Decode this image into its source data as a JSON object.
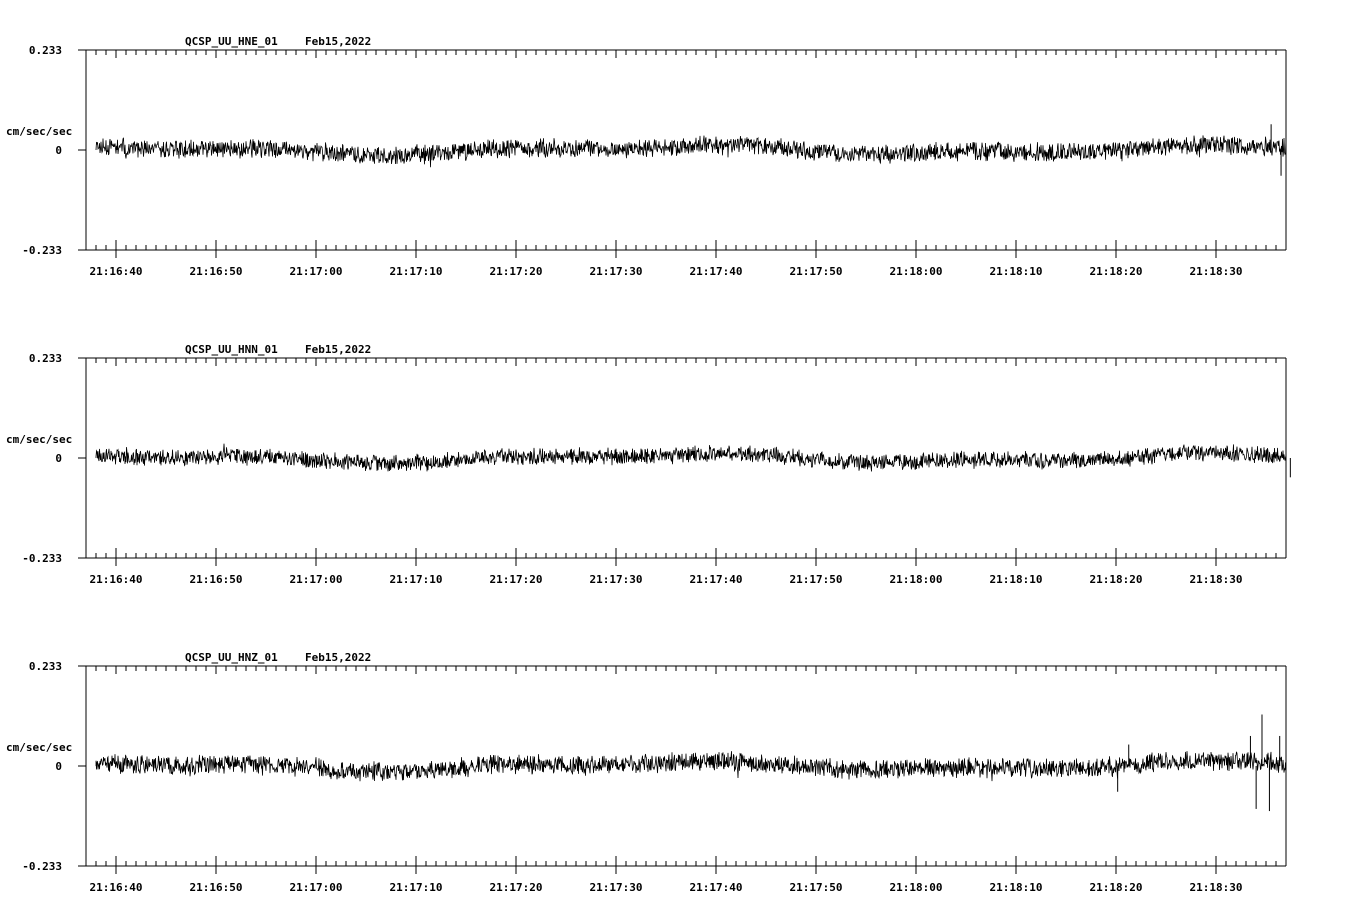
{
  "chart_data": [
    {
      "type": "line",
      "title": "QCSP_UU_HNE_01",
      "date": "Feb15,2022",
      "ylabel": "cm/sec/sec",
      "ylim": [
        -0.233,
        0.233
      ],
      "y_ticks": [
        "0.233",
        "0",
        "-0.233"
      ],
      "x_start": "21:16:37",
      "x_end": "21:18:37",
      "x_ticks": [
        "21:16:40",
        "21:16:50",
        "21:17:00",
        "21:17:10",
        "21:17:20",
        "21:17:30",
        "21:17:40",
        "21:17:50",
        "21:18:00",
        "21:18:10",
        "21:18:20",
        "21:18:30"
      ],
      "signal": {
        "data_start": "21:16:38",
        "noise_amplitude": 0.025,
        "drift_amplitude": 0.008,
        "seed": 11,
        "spikes": [
          {
            "time": "21:18:35",
            "amplitude": 0.06
          },
          {
            "time": "21:18:36",
            "amplitude": -0.06
          }
        ]
      }
    },
    {
      "type": "line",
      "title": "QCSP_UU_HNN_01",
      "date": "Feb15,2022",
      "ylabel": "cm/sec/sec",
      "ylim": [
        -0.233,
        0.233
      ],
      "y_ticks": [
        "0.233",
        "0",
        "-0.233"
      ],
      "x_start": "21:16:37",
      "x_end": "21:18:37",
      "x_ticks": [
        "21:16:40",
        "21:16:50",
        "21:17:00",
        "21:17:10",
        "21:17:20",
        "21:17:30",
        "21:17:40",
        "21:17:50",
        "21:18:00",
        "21:18:10",
        "21:18:20",
        "21:18:30"
      ],
      "signal": {
        "data_start": "21:16:38",
        "noise_amplitude": 0.022,
        "drift_amplitude": 0.008,
        "seed": 23,
        "spikes": [
          {
            "time": "21:18:37",
            "amplitude": -0.045
          }
        ]
      }
    },
    {
      "type": "line",
      "title": "QCSP_UU_HNZ_01",
      "date": "Feb15,2022",
      "ylabel": "cm/sec/sec",
      "ylim": [
        -0.233,
        0.233
      ],
      "y_ticks": [
        "0.233",
        "0",
        "-0.233"
      ],
      "x_start": "21:16:37",
      "x_end": "21:18:37",
      "x_ticks": [
        "21:16:40",
        "21:16:50",
        "21:17:00",
        "21:17:10",
        "21:17:20",
        "21:17:30",
        "21:17:40",
        "21:17:50",
        "21:18:00",
        "21:18:10",
        "21:18:20",
        "21:18:30"
      ],
      "signal": {
        "data_start": "21:16:38",
        "noise_amplitude": 0.026,
        "drift_amplitude": 0.008,
        "seed": 37,
        "spikes": [
          {
            "time": "21:18:20",
            "amplitude": -0.06
          },
          {
            "time": "21:18:21",
            "amplitude": 0.05
          },
          {
            "time": "21:18:33",
            "amplitude": 0.07
          },
          {
            "time": "21:18:34",
            "amplitude": 0.12
          },
          {
            "time": "21:18:34",
            "amplitude": -0.1
          },
          {
            "time": "21:18:35",
            "amplitude": -0.105
          },
          {
            "time": "21:18:36",
            "amplitude": 0.07
          }
        ]
      }
    }
  ]
}
